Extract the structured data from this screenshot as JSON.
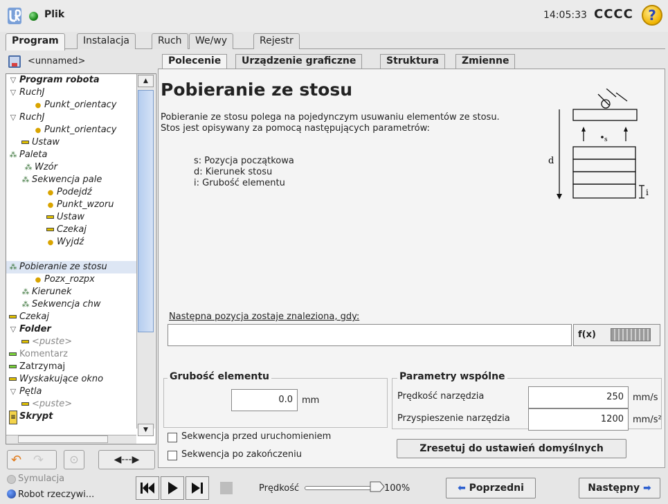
{
  "topbar": {
    "file_label": "Plik",
    "clock": "14:05:33",
    "robot_name": "CCCC",
    "help": "?"
  },
  "main_tabs": [
    "Program",
    "Instalacja",
    "Ruch",
    "We/wy",
    "Rejestr"
  ],
  "program": {
    "name": "<unnamed>"
  },
  "tree": [
    {
      "label": "Program robota",
      "icon": "triangle",
      "bold": true
    },
    {
      "label": "RuchJ",
      "icon": "triangle"
    },
    {
      "label": "Punkt_orientacy",
      "icon": "dot"
    },
    {
      "label": "RuchJ",
      "icon": "triangle"
    },
    {
      "label": "Punkt_orientacy",
      "icon": "dot"
    },
    {
      "label": "Ustaw",
      "icon": "dash"
    },
    {
      "label": "Paleta",
      "icon": "pallet"
    },
    {
      "label": "Wzór",
      "icon": "pallet"
    },
    {
      "label": "Sekwencja pale",
      "icon": "pallet"
    },
    {
      "label": "Podejdź",
      "icon": "dot"
    },
    {
      "label": "Punkt_wzoru",
      "icon": "dot"
    },
    {
      "label": "Ustaw",
      "icon": "dash"
    },
    {
      "label": "Czekaj",
      "icon": "dash"
    },
    {
      "label": "Wyjdź",
      "icon": "dot"
    },
    {
      "label": "Pobieranie ze stosu",
      "icon": "pallet",
      "selected": true
    },
    {
      "label": "Pozx_rozpx",
      "icon": "dot"
    },
    {
      "label": "Kierunek",
      "icon": "pallet"
    },
    {
      "label": "Sekwencja chw",
      "icon": "pallet"
    },
    {
      "label": "Czekaj",
      "icon": "dash"
    },
    {
      "label": "Folder",
      "icon": "triangle",
      "bold": true
    },
    {
      "label": "<puste>",
      "icon": "dash",
      "grey": true
    },
    {
      "label": "Komentarz",
      "icon": "dash-g",
      "grey": true
    },
    {
      "label": "Zatrzymaj",
      "icon": "dash-g"
    },
    {
      "label": "Wyskakujące okno",
      "icon": "dash"
    },
    {
      "label": "Pętla",
      "icon": "triangle"
    },
    {
      "label": "<puste>",
      "icon": "dash",
      "grey": true
    },
    {
      "label": "Skrypt",
      "icon": "script",
      "bold": true
    }
  ],
  "sub_tabs": [
    "Polecenie",
    "Urządzenie graficzne",
    "Struktura",
    "Zmienne"
  ],
  "command": {
    "title": "Pobieranie ze stosu",
    "description_1": "Pobieranie ze stosu polega na pojedynczym usuwaniu elementów ze stosu.",
    "description_2": "Stos jest opisywany za pomocą następujących parametrów:",
    "param_s": "s: Pozycja początkowa",
    "param_d": "d: Kierunek stosu",
    "param_i": "i: Grubość elementu",
    "diagram": {
      "label_s": "s",
      "label_d": "d",
      "label_i": "i"
    },
    "next_pos_label": "Następna pozycja zostaje znaleziona, gdy:",
    "expression_value": "",
    "fx_label": "f(x)",
    "thickness_legend": "Grubość elementu",
    "thickness_value": "0.0",
    "thickness_unit": "mm",
    "seq_before": "Sekwencja przed uruchomieniem",
    "seq_after": "Sekwencja po zakończeniu",
    "common_legend": "Parametry wspólne",
    "tool_speed_label": "Prędkość narzędzia",
    "tool_speed_value": "250",
    "tool_speed_unit": "mm/s",
    "tool_accel_label": "Przyspieszenie narzędzia",
    "tool_accel_value": "1200",
    "tool_accel_unit": "mm/s²",
    "reset_label": "Zresetuj do ustawień domyślnych"
  },
  "bottom": {
    "sim_label": "Symulacja",
    "real_label": "Robot rzeczywi...",
    "speed_label": "Prędkość",
    "speed_percent": "100%",
    "speed_fraction": 1.0,
    "prev_label": "Poprzedni",
    "next_label": "Następny"
  },
  "colors": {
    "accent_blue": "#2c5fcf",
    "selection": "#dde6f4",
    "status_green": "#1d8a1d"
  }
}
